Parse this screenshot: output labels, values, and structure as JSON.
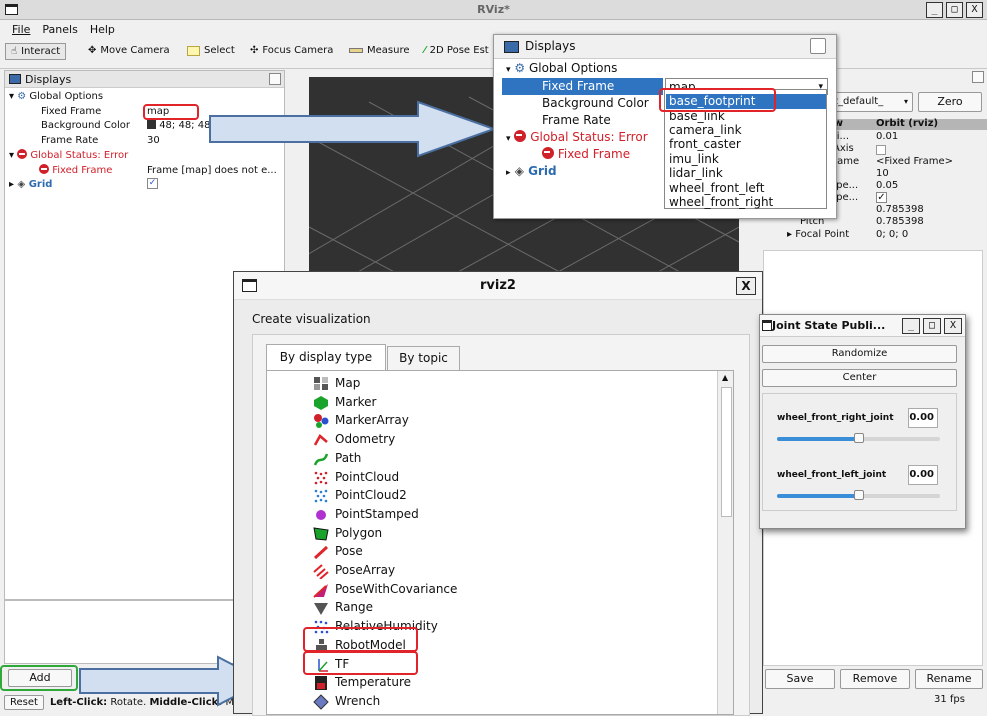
{
  "window": {
    "title": "RViz*",
    "buttons": [
      "_",
      "□",
      "X"
    ]
  },
  "menu": [
    "File",
    "Panels",
    "Help"
  ],
  "toolbar": [
    "Interact",
    "Move Camera",
    "Select",
    "Focus Camera",
    "Measure",
    "2D Pose Est"
  ],
  "displays_panel": {
    "title": "Displays",
    "rows": [
      {
        "label": "Global Options",
        "value": ""
      },
      {
        "label": "Fixed Frame",
        "value": "map"
      },
      {
        "label": "Background Color",
        "value": "48; 48; 48"
      },
      {
        "label": "Frame Rate",
        "value": "30"
      },
      {
        "label": "Global Status: Error",
        "value": ""
      },
      {
        "label": "Fixed Frame",
        "value": "Frame [map] does not e..."
      },
      {
        "label": "Grid",
        "value": ""
      }
    ]
  },
  "bottom_left": {
    "add": "Add",
    "reset": "Reset",
    "hint_bold1": "Left-Click:",
    "hint1": " Rotate. ",
    "hint_bold2": "Middle-Click:",
    "hint2": " M"
  },
  "views_panel": {
    "type_value": "iz_default_",
    "zero": "Zero",
    "header_left": "ew",
    "header_right": "Orbit (rviz)",
    "rows": [
      {
        "label": "Di...",
        "value": "0.01"
      },
      {
        "label": "Axis",
        "value": ""
      },
      {
        "label": "rame",
        "value": "<Fixed Frame>"
      },
      {
        "label": "",
        "value": "10"
      },
      {
        "label": "ape...",
        "value": "0.05"
      },
      {
        "label": "ape...",
        "value": "✓"
      },
      {
        "label": "",
        "value": "0.785398"
      },
      {
        "label": "Pitch",
        "value": "0.785398"
      },
      {
        "label": "Focal Point",
        "value": "0; 0; 0"
      }
    ],
    "save": "Save",
    "remove": "Remove",
    "rename": "Rename",
    "fps": "31 fps"
  },
  "popup": {
    "title": "Displays",
    "global_options": "Global Options",
    "fixed_frame": "Fixed Frame",
    "fixed_frame_value": "map",
    "background_color": "Background Color",
    "frame_rate": "Frame Rate",
    "global_status": "Global Status: Error",
    "fixed_frame_err": "Fixed Frame",
    "grid": "Grid",
    "frames": [
      "base_footprint",
      "base_link",
      "camera_link",
      "front_caster",
      "imu_link",
      "lidar_link",
      "wheel_front_left",
      "wheel_front_right"
    ]
  },
  "dialog": {
    "title": "rviz2",
    "close": "X",
    "heading": "Create visualization",
    "tabs": [
      "By display type",
      "By topic"
    ],
    "items": [
      {
        "label": "Map",
        "icon": "map-icon",
        "color": "#555555"
      },
      {
        "label": "Marker",
        "icon": "marker-icon",
        "color": "#1aa32a"
      },
      {
        "label": "MarkerArray",
        "icon": "marker-array-icon",
        "color": "#d0202a"
      },
      {
        "label": "Odometry",
        "icon": "odometry-icon",
        "color": "#e0242a"
      },
      {
        "label": "Path",
        "icon": "path-icon",
        "color": "#1aa32a"
      },
      {
        "label": "PointCloud",
        "icon": "point-cloud-icon",
        "color": "#d0202a"
      },
      {
        "label": "PointCloud2",
        "icon": "point-cloud2-icon",
        "color": "#2a7fd0"
      },
      {
        "label": "PointStamped",
        "icon": "point-stamped-icon",
        "color": "#b030d0"
      },
      {
        "label": "Polygon",
        "icon": "polygon-icon",
        "color": "#1aa32a"
      },
      {
        "label": "Pose",
        "icon": "pose-icon",
        "color": "#e0242a"
      },
      {
        "label": "PoseArray",
        "icon": "pose-array-icon",
        "color": "#e0242a"
      },
      {
        "label": "PoseWithCovariance",
        "icon": "pose-covariance-icon",
        "color": "#c0207a"
      },
      {
        "label": "Range",
        "icon": "range-icon",
        "color": "#555555"
      },
      {
        "label": "RelativeHumidity",
        "icon": "humidity-icon",
        "color": "#2a50d0"
      },
      {
        "label": "RobotModel",
        "icon": "robot-model-icon",
        "color": "#555555"
      },
      {
        "label": "TF",
        "icon": "tf-icon",
        "color": "#1aa32a"
      },
      {
        "label": "Temperature",
        "icon": "temperature-icon",
        "color": "#d0202a"
      },
      {
        "label": "Wrench",
        "icon": "wrench-icon",
        "color": "#6a7ac0"
      }
    ]
  },
  "joint_state": {
    "title": "Joint State Publi...",
    "randomize": "Randomize",
    "center": "Center",
    "joints": [
      {
        "name": "wheel_front_right_joint",
        "value": "0.00",
        "position": 0.5
      },
      {
        "name": "wheel_front_left_joint",
        "value": "0.00",
        "position": 0.5
      }
    ]
  },
  "colors": {
    "error": "#d0202a",
    "selection": "#2f74c0",
    "highlight": "#e0242a",
    "add_highlight": "#2ea838",
    "arrow_fill": "#d2dff0",
    "arrow_stroke": "#4a6fa0"
  }
}
